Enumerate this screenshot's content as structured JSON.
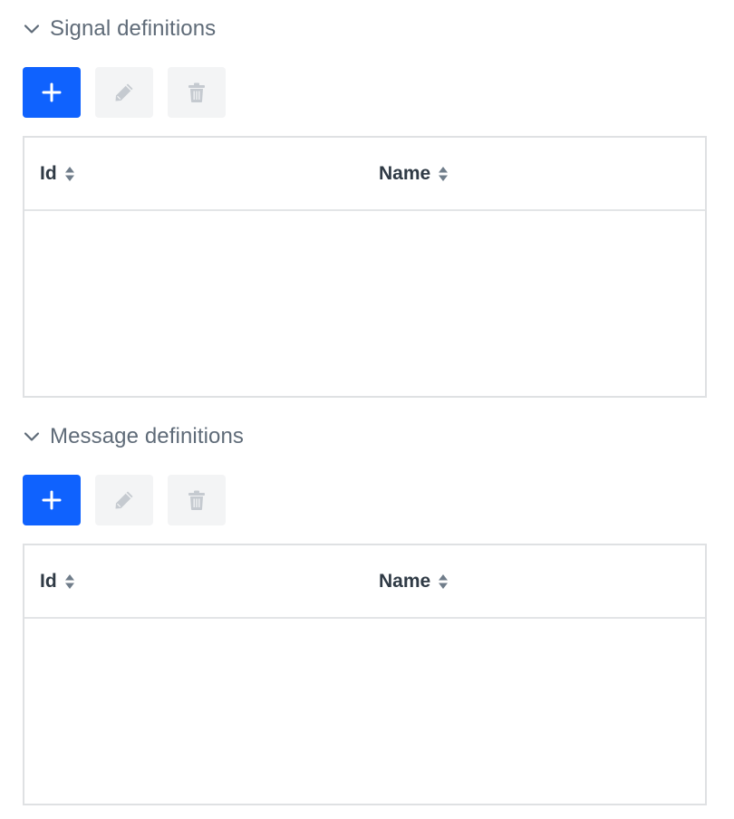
{
  "sections": [
    {
      "title": "Signal definitions",
      "columns": [
        "Id",
        "Name"
      ],
      "rows": []
    },
    {
      "title": "Message definitions",
      "columns": [
        "Id",
        "Name"
      ],
      "rows": []
    }
  ],
  "icons": {
    "collapse": "chevron-down-icon",
    "add": "plus-icon",
    "edit": "pencil-icon",
    "delete": "trash-icon",
    "sort": "sort-icon"
  },
  "colors": {
    "primary": "#0f62fe",
    "disabled_bg": "#f3f4f5",
    "disabled_icon": "#c5cad0",
    "title": "#5f6b78",
    "header_text": "#2f3a45",
    "border": "#dfe1e3"
  }
}
